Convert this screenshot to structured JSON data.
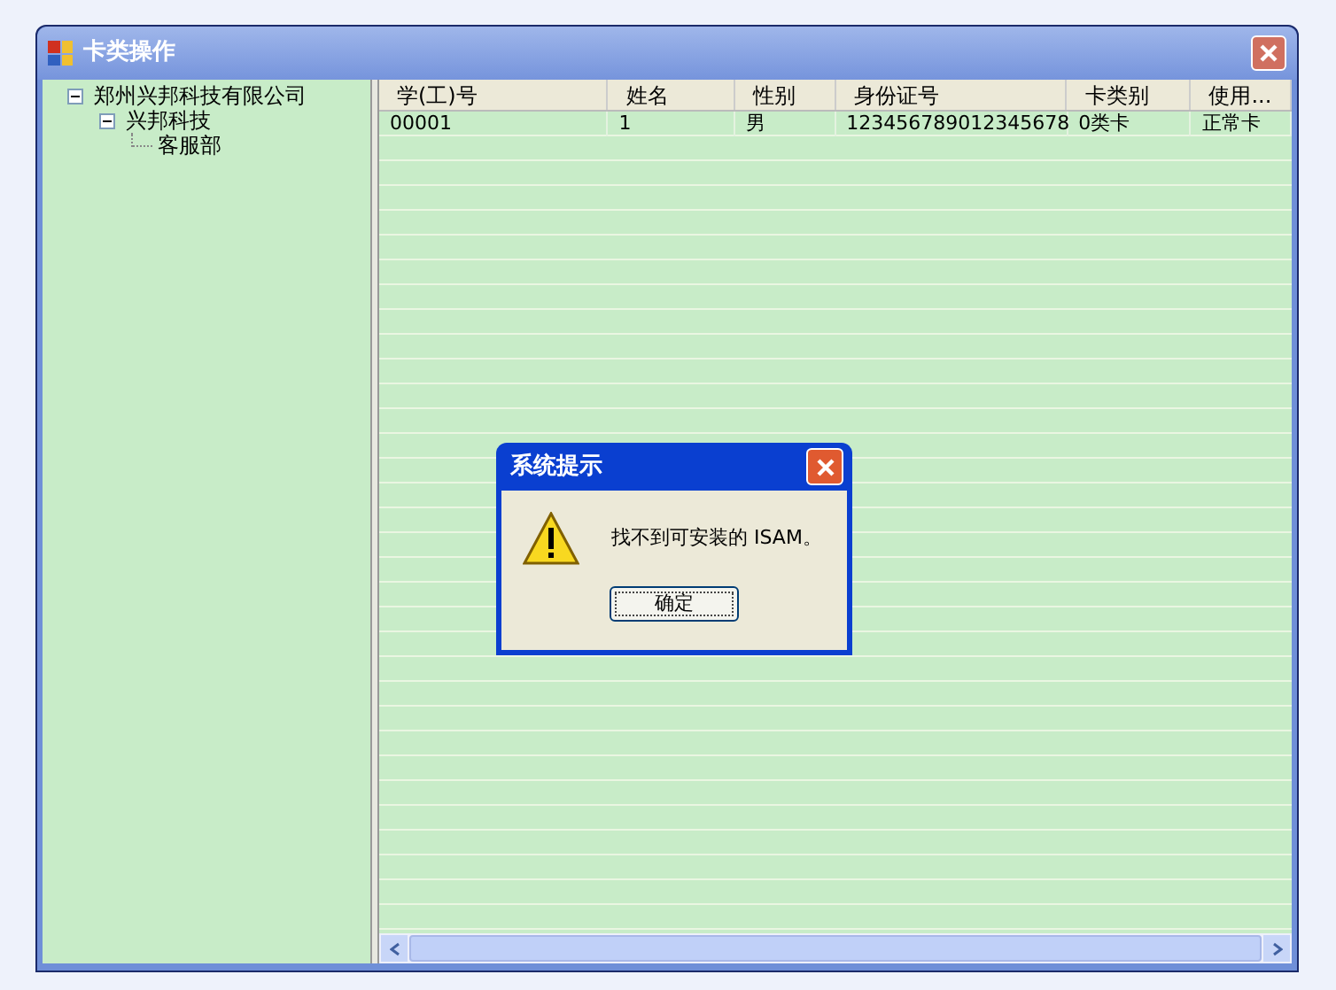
{
  "window": {
    "title": "卡类操作"
  },
  "tree": [
    {
      "label": "郑州兴邦科技有限公司",
      "expanded": true,
      "children": [
        {
          "label": "兴邦科技",
          "expanded": true,
          "children": [
            {
              "label": "客服部"
            }
          ]
        }
      ]
    }
  ],
  "table": {
    "columns": [
      "学(工)号",
      "姓名",
      "性别",
      "身份证号",
      "卡类别",
      "使用..."
    ],
    "rows": [
      [
        "00001",
        "1",
        "男",
        "123456789012345678",
        "0类卡",
        "正常卡"
      ]
    ]
  },
  "dialog": {
    "title": "系统提示",
    "message": "找不到可安装的 ISAM。",
    "button": "确定"
  }
}
